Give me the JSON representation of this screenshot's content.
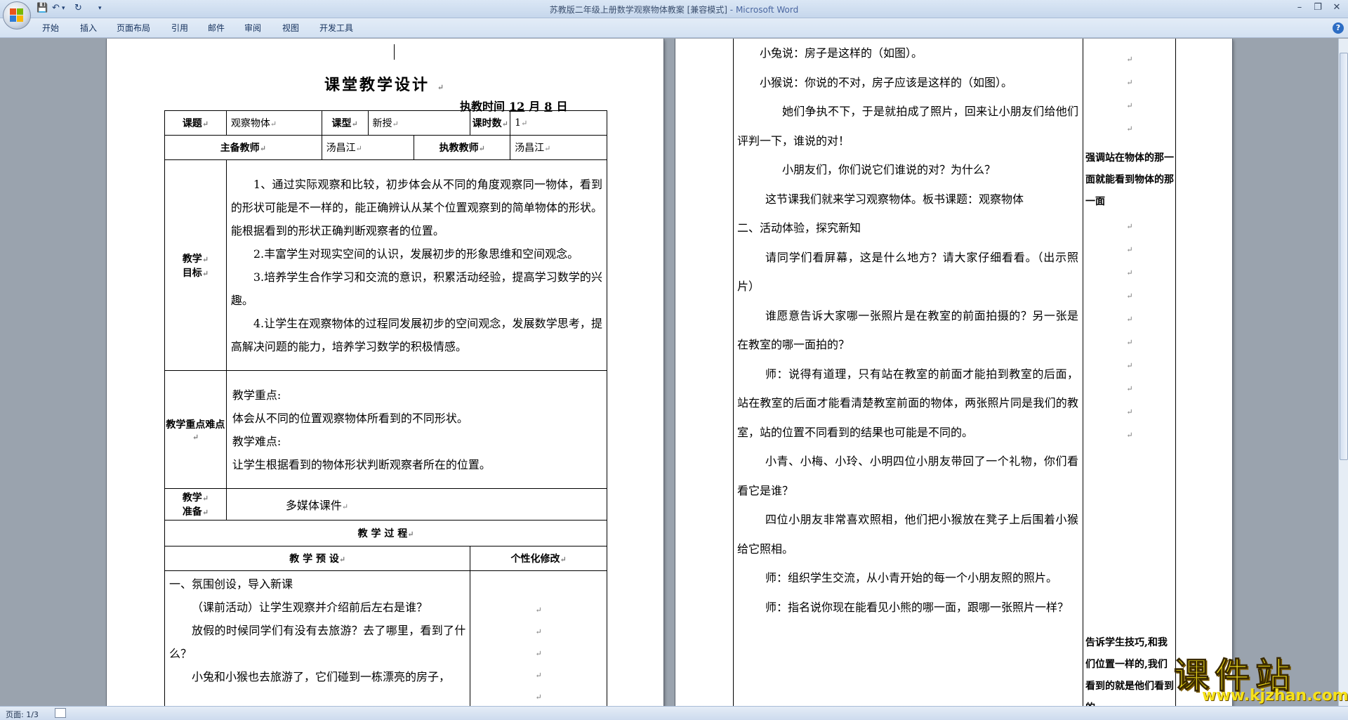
{
  "window": {
    "title": "苏教版二年级上册数学观察物体教案 [兼容模式]",
    "app_name": "- Microsoft Word"
  },
  "ribbon_tabs": [
    "开始",
    "插入",
    "页面布局",
    "引用",
    "邮件",
    "审阅",
    "视图",
    "开发工具"
  ],
  "status": {
    "page": "页面: 1/3"
  },
  "page1": {
    "title": "课堂教学设计",
    "exec_time_label": "执教时间",
    "exec_month": "12",
    "month_unit": "月",
    "exec_day": "8",
    "day_unit": "日",
    "row1": {
      "topic_label": "课题",
      "topic_value": "观察物体",
      "type_label": "课型",
      "type_value": "新授",
      "hours_label": "课时数",
      "hours_value": "1"
    },
    "row2": {
      "lead_teacher_label": "主备教师",
      "lead_teacher_value": "汤昌江",
      "exec_teacher_label": "执教教师",
      "exec_teacher_value": "汤昌江"
    },
    "objectives_label_1": "教学",
    "objectives_label_2": "目标",
    "objectives": [
      "1、通过实际观察和比较，初步体会从不同的角度观察同一物体，看到的形状可能是不一样的，能正确辨认从某个位置观察到的简单物体的形状。能根据看到的形状正确判断观察者的位置。",
      "2.丰富学生对现实空间的认识，发展初步的形象思维和空间观念。",
      "3.培养学生合作学习和交流的意识，积累活动经验，提高学习数学的兴趣。",
      "4.让学生在观察物体的过程同发展初步的空间观念，发展数学思考，提高解决问题的能力，培养学习数学的积极情感。"
    ],
    "key_label": "教学重点难点",
    "key_point_title": "教学重点:",
    "key_point": "体会从不同的位置观察物体所看到的不同形状。",
    "difficulty_title": "教学难点:",
    "difficulty": "让学生根据看到的物体形状判断观察者所在的位置。",
    "prep_label_1": "教学",
    "prep_label_2": "准备",
    "prep_value": "多媒体课件",
    "process_label": "教 学 过 程",
    "design_label": "教 学 预 设",
    "personal_label": "个性化修改",
    "section1_title": "一、氛围创设，导入新课",
    "section1_paras": [
      "（课前活动）让学生观察并介绍前后左右是谁？",
      "放假的时候同学们有没有去旅游？去了哪里，看到了什么？",
      "小兔和小猴也去旅游了，它们碰到一栋漂亮的房子，"
    ]
  },
  "page2": {
    "paras": [
      "小兔说：房子是这样的（如图）。",
      "小猴说：你说的不对，房子应该是这样的（如图）。",
      "她们争执不下，于是就拍成了照片，回来让小朋友们给他们评判一下，谁说的对！",
      "小朋友们，你们说它们谁说的对？为什么？",
      "这节课我们就来学习观察物体。板书课题：观察物体",
      "二、活动体验，探究新知",
      "请同学们看屏幕，这是什么地方？请大家仔细看看。（出示照片）",
      "谁愿意告诉大家哪一张照片是在教室的前面拍摄的？另一张是在教室的哪一面拍的？",
      "师：说得有道理，只有站在教室的前面才能拍到教室的后面，站在教室的后面才能看清楚教室前面的物体，两张照片同是我们的教室，站的位置不同看到的结果也可能是不同的。",
      "小青、小梅、小玲、小明四位小朋友带回了一个礼物，你们看看它是谁？",
      "四位小朋友非常喜欢照相，他们把小猴放在凳子上后围着小猴给它照相。",
      "师：组织学生交流，从小青开始的每一个小朋友照的照片。",
      "师：指名说你现在能看见小熊的哪一面，跟哪一张照片一样？"
    ],
    "side_note_1": "强调站在物体的那一面就能看到物体的那一面",
    "side_note_2": "告诉学生技巧,和我们位置一样的,我们看到的就是他们看到的"
  },
  "watermark": {
    "main": "课件站",
    "url": "www.kjzhan.com"
  }
}
